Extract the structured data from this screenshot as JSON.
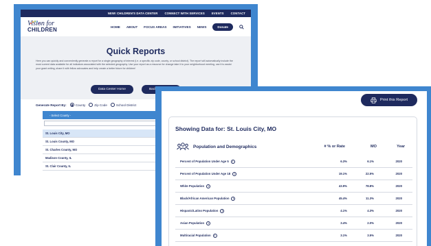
{
  "back": {
    "topbar": [
      "NEW! CHILDREN'S DATA CENTER",
      "CONNECT WITH SERVICES",
      "EVENTS",
      "CONTACT"
    ],
    "logo_top": "Vision for",
    "logo_bottom": "CHILDREN",
    "nav": [
      "HOME",
      "ABOUT",
      "FOCUS AREAS",
      "INITIATIVES",
      "NEWS"
    ],
    "donate_label": "Donate",
    "page_title": "Quick Reports",
    "description": "Here you can quickly and conveniently generate a report for a single geography of interest (i.e. a specific zip code, county, or school district). The report will automatically include the most current data available for all indicators associated with the selected geography. Use your report as a resource for change take it to your neighborhood meeting, use it to assist your grant writing, share it with fellow advocates and help create a better future for children!",
    "buttons": [
      "Data Center Home",
      "Back To Reports"
    ],
    "generate_label": "Generate Report By:",
    "options": [
      "County",
      "Zip Code",
      "School District"
    ],
    "select_placeholder": "- Select County -",
    "counties": [
      "St. Louis City, MO",
      "St. Louis County, MO",
      "St. Charles County, MO",
      "Madison County, IL",
      "St. Clair County, IL"
    ]
  },
  "front": {
    "print_label": "Print this Report",
    "showing_title": "Showing Data for: St. Louis City, MO",
    "section_label": "Population and Demographics",
    "columns": [
      "# % or Rate",
      "MO",
      "Year"
    ],
    "rows": [
      {
        "label": "Percent of Population Under Age 5",
        "value": "6.3%",
        "mo": "6.1%",
        "year": "2020"
      },
      {
        "label": "Percent of Population Under Age 18",
        "value": "19.1%",
        "mo": "22.5%",
        "year": "2020"
      },
      {
        "label": "White Population",
        "value": "43.9%",
        "mo": "78.8%",
        "year": "2020"
      },
      {
        "label": "Black/African American Population",
        "value": "45.4%",
        "mo": "11.3%",
        "year": "2020"
      },
      {
        "label": "Hispanic/Latino Population",
        "value": "4.1%",
        "mo": "4.3%",
        "year": "2020"
      },
      {
        "label": "Asian Population",
        "value": "3.4%",
        "mo": "2.0%",
        "year": "2020"
      },
      {
        "label": "Multiracial Population",
        "value": "3.1%",
        "mo": "3.5%",
        "year": "2020"
      }
    ]
  },
  "colors": {
    "navy": "#1e2a5e",
    "blue": "#3f86cf"
  }
}
